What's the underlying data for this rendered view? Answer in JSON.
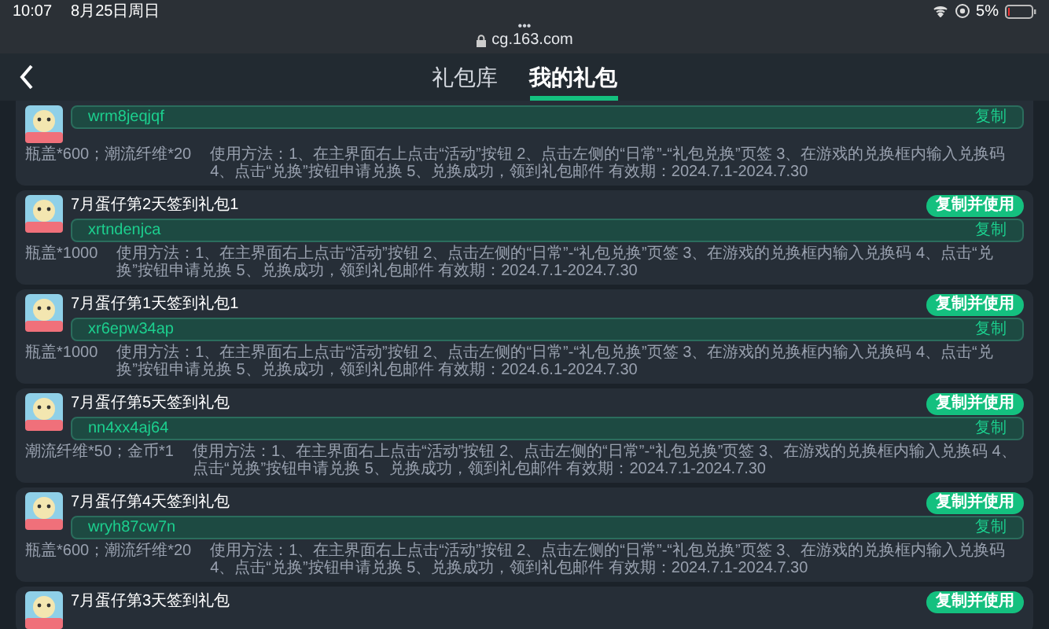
{
  "status_bar": {
    "time": "10:07",
    "date": "8月25日周日",
    "dots": "•••",
    "url": "cg.163.com",
    "battery": "5%"
  },
  "tabs": [
    {
      "label": "礼包库",
      "selected": false
    },
    {
      "label": "我的礼包",
      "selected": true
    }
  ],
  "gifts": [
    {
      "code": "wrm8jeqjqf",
      "copy": "复制",
      "reward": "瓶盖*600；潮流纤维*20",
      "usage": "使用方法：1、在主界面右上点击“活动”按钮 2、点击左侧的“日常”-“礼包兑换”页签 3、在游戏的兑换框内输入兑换码 4、点击“兑换”按钮申请兑换 5、兑换成功，领到礼包邮件 有效期：2024.7.1-2024.7.30"
    },
    {
      "title": "7月蛋仔第2天签到礼包1",
      "use_button": "复制并使用",
      "code": "xrtndenjca",
      "copy": "复制",
      "reward": "瓶盖*1000",
      "usage": "使用方法：1、在主界面右上点击“活动”按钮 2、点击左侧的“日常”-“礼包兑换”页签 3、在游戏的兑换框内输入兑换码 4、点击“兑换”按钮申请兑换 5、兑换成功，领到礼包邮件 有效期：2024.7.1-2024.7.30"
    },
    {
      "title": "7月蛋仔第1天签到礼包1",
      "use_button": "复制并使用",
      "code": "xr6epw34ap",
      "copy": "复制",
      "reward": "瓶盖*1000",
      "usage": "使用方法：1、在主界面右上点击“活动”按钮 2、点击左侧的“日常”-“礼包兑换”页签 3、在游戏的兑换框内输入兑换码 4、点击“兑换”按钮申请兑换 5、兑换成功，领到礼包邮件 有效期：2024.6.1-2024.7.30"
    },
    {
      "title": "7月蛋仔第5天签到礼包",
      "use_button": "复制并使用",
      "code": "nn4xx4aj64",
      "copy": "复制",
      "reward": "潮流纤维*50；金币*1",
      "usage": "使用方法：1、在主界面右上点击“活动”按钮 2、点击左侧的“日常”-“礼包兑换”页签 3、在游戏的兑换框内输入兑换码 4、点击“兑换”按钮申请兑换 5、兑换成功，领到礼包邮件 有效期：2024.7.1-2024.7.30"
    },
    {
      "title": "7月蛋仔第4天签到礼包",
      "use_button": "复制并使用",
      "code": "wryh87cw7n",
      "copy": "复制",
      "reward": "瓶盖*600；潮流纤维*20",
      "usage": "使用方法：1、在主界面右上点击“活动”按钮 2、点击左侧的“日常”-“礼包兑换”页签 3、在游戏的兑换框内输入兑换码 4、点击“兑换”按钮申请兑换 5、兑换成功，领到礼包邮件 有效期：2024.7.1-2024.7.30"
    },
    {
      "title": "7月蛋仔第3天签到礼包",
      "use_button": "复制并使用"
    }
  ]
}
